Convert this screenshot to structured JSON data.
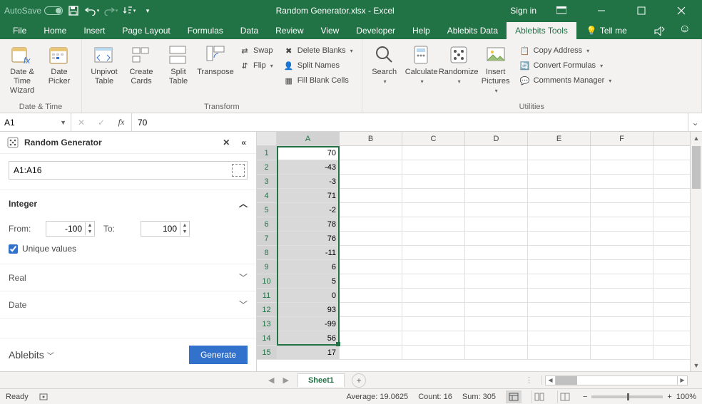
{
  "titlebar": {
    "autosave_label": "AutoSave",
    "title": "Random Generator.xlsx - Excel",
    "signin": "Sign in"
  },
  "tabs": {
    "file": "File",
    "home": "Home",
    "insert": "Insert",
    "pagelayout": "Page Layout",
    "formulas": "Formulas",
    "data": "Data",
    "review": "Review",
    "view": "View",
    "developer": "Developer",
    "help": "Help",
    "ablebits_data": "Ablebits Data",
    "ablebits_tools": "Ablebits Tools",
    "tellme": "Tell me"
  },
  "ribbon": {
    "datetime_wizard": "Date & Time Wizard",
    "date_picker": "Date Picker",
    "group_datetime": "Date & Time",
    "unpivot_table": "Unpivot Table",
    "create_cards": "Create Cards",
    "split_table": "Split Table",
    "transpose": "Transpose",
    "swap": "Swap",
    "flip": "Flip",
    "delete_blanks": "Delete Blanks",
    "split_names": "Split Names",
    "fill_blank": "Fill Blank Cells",
    "group_transform": "Transform",
    "search": "Search",
    "calculate": "Calculate",
    "randomize": "Randomize",
    "insert_pictures": "Insert Pictures",
    "copy_address": "Copy Address",
    "convert_formulas": "Convert Formulas",
    "comments_manager": "Comments Manager",
    "group_utilities": "Utilities"
  },
  "fbar": {
    "name": "A1",
    "value": "70"
  },
  "taskpane": {
    "title": "Random Generator",
    "range": "A1:A16",
    "integer_label": "Integer",
    "from_label": "From:",
    "to_label": "To:",
    "from_value": "-100",
    "to_value": "100",
    "unique_label": "Unique values",
    "real_label": "Real",
    "date_label": "Date",
    "brand": "Ablebits",
    "generate": "Generate"
  },
  "grid": {
    "columns": [
      "A",
      "B",
      "C",
      "D",
      "E",
      "F"
    ],
    "rows": [
      {
        "n": 1,
        "a": "70"
      },
      {
        "n": 2,
        "a": "-43"
      },
      {
        "n": 3,
        "a": "-3"
      },
      {
        "n": 4,
        "a": "71"
      },
      {
        "n": 5,
        "a": "-2"
      },
      {
        "n": 6,
        "a": "78"
      },
      {
        "n": 7,
        "a": "76"
      },
      {
        "n": 8,
        "a": "-11"
      },
      {
        "n": 9,
        "a": "6"
      },
      {
        "n": 10,
        "a": "5"
      },
      {
        "n": 11,
        "a": "0"
      },
      {
        "n": 12,
        "a": "93"
      },
      {
        "n": 13,
        "a": "-99"
      },
      {
        "n": 14,
        "a": "56"
      },
      {
        "n": 15,
        "a": "17"
      }
    ]
  },
  "sheettabs": {
    "sheet1": "Sheet1"
  },
  "statusbar": {
    "ready": "Ready",
    "average": "Average: 19.0625",
    "count": "Count: 16",
    "sum": "Sum: 305",
    "zoom": "100%"
  }
}
